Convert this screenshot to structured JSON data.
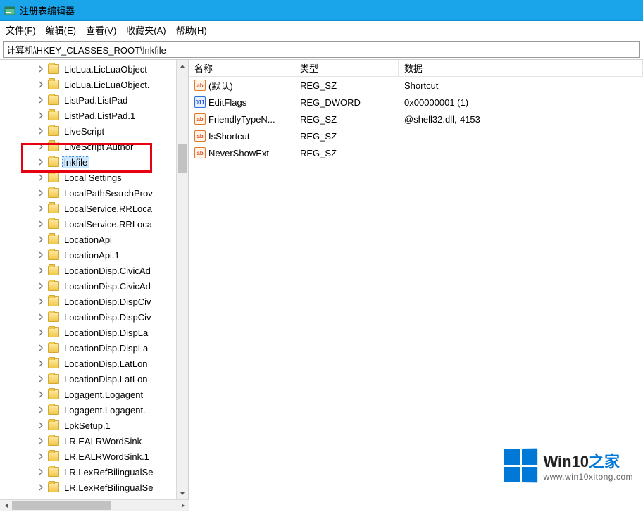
{
  "window": {
    "title": "注册表编辑器"
  },
  "menu": {
    "file": "文件(F)",
    "edit": "编辑(E)",
    "view": "查看(V)",
    "favorites": "收藏夹(A)",
    "help": "帮助(H)"
  },
  "address": {
    "path": "计算机\\HKEY_CLASSES_ROOT\\lnkfile"
  },
  "tree": {
    "items": [
      {
        "label": "LicLua.LicLuaObject"
      },
      {
        "label": "LicLua.LicLuaObject."
      },
      {
        "label": "ListPad.ListPad"
      },
      {
        "label": "ListPad.ListPad.1"
      },
      {
        "label": "LiveScript"
      },
      {
        "label": "LiveScript Author"
      },
      {
        "label": "lnkfile",
        "selected": true
      },
      {
        "label": "Local Settings"
      },
      {
        "label": "LocalPathSearchProv"
      },
      {
        "label": "LocalService.RRLoca"
      },
      {
        "label": "LocalService.RRLoca"
      },
      {
        "label": "LocationApi"
      },
      {
        "label": "LocationApi.1"
      },
      {
        "label": "LocationDisp.CivicAd"
      },
      {
        "label": "LocationDisp.CivicAd"
      },
      {
        "label": "LocationDisp.DispCiv"
      },
      {
        "label": "LocationDisp.DispCiv"
      },
      {
        "label": "LocationDisp.DispLa"
      },
      {
        "label": "LocationDisp.DispLa"
      },
      {
        "label": "LocationDisp.LatLon"
      },
      {
        "label": "LocationDisp.LatLon"
      },
      {
        "label": "Logagent.Logagent"
      },
      {
        "label": "Logagent.Logagent."
      },
      {
        "label": "LpkSetup.1"
      },
      {
        "label": "LR.EALRWordSink"
      },
      {
        "label": "LR.EALRWordSink.1"
      },
      {
        "label": "LR.LexRefBilingualSe"
      },
      {
        "label": "LR.LexRefBilingualSe"
      }
    ]
  },
  "list": {
    "columns": {
      "name": "名称",
      "type": "类型",
      "data": "数据"
    },
    "rows": [
      {
        "icon": "str",
        "name": "(默认)",
        "type": "REG_SZ",
        "data": "Shortcut"
      },
      {
        "icon": "bin",
        "name": "EditFlags",
        "type": "REG_DWORD",
        "data": "0x00000001 (1)"
      },
      {
        "icon": "str",
        "name": "FriendlyTypeN...",
        "type": "REG_SZ",
        "data": "@shell32.dll,-4153"
      },
      {
        "icon": "str",
        "name": "IsShortcut",
        "type": "REG_SZ",
        "data": ""
      },
      {
        "icon": "str",
        "name": "NeverShowExt",
        "type": "REG_SZ",
        "data": ""
      }
    ],
    "icon_text": {
      "str": "ab",
      "bin": "011"
    }
  },
  "watermark": {
    "brand_prefix": "Win10",
    "brand_suffix": "之家",
    "url": "www.win10xitong.com"
  }
}
